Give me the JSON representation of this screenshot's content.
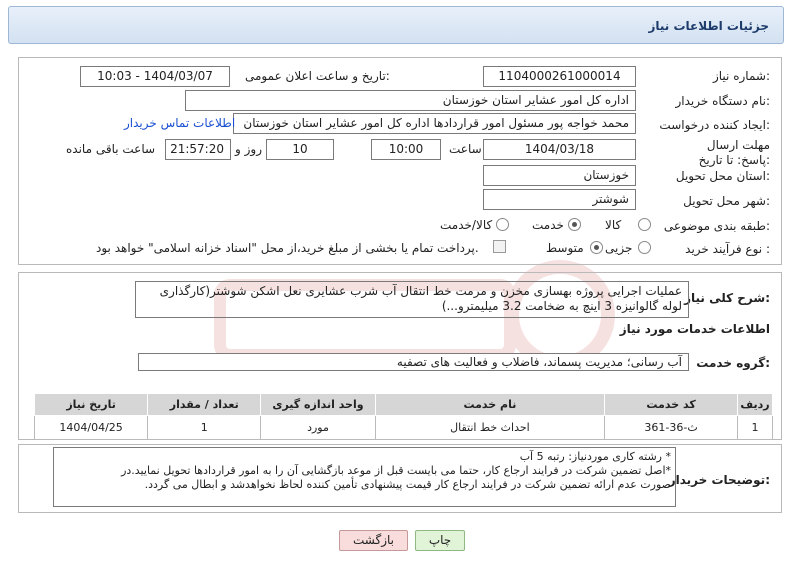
{
  "header": {
    "title": "جزئیات اطلاعات نیاز"
  },
  "fields": {
    "need_number_label": "شماره نیاز:",
    "need_number": "1104000261000014",
    "announce_label": "تاریخ و ساعت اعلان عمومی:",
    "announce_value": "1404/03/07 - 10:03",
    "buyer_label": "نام دستگاه خریدار:",
    "buyer_value": "اداره کل امور عشایر استان خوزستان",
    "creator_label": "ایجاد کننده درخواست:",
    "creator_value": "محمد خواجه پور مسئول امور قراردادها اداره کل امور عشایر استان خوزستان",
    "contact_link": "اطلاعات تماس خریدار",
    "deadline_label": "مهلت ارسال پاسخ: تا تاریخ:",
    "deadline_date": "1404/03/18",
    "time_label": "ساعت",
    "deadline_time": "10:00",
    "days_value": "10",
    "days_label": "روز و",
    "remaining_time": "21:57:20",
    "remaining_label": "ساعت باقی مانده",
    "province_label": "استان محل تحویل:",
    "province_value": "خوزستان",
    "city_label": "شهر محل تحویل:",
    "city_value": "شوشتر",
    "category_label": "طبقه بندی موضوعی:",
    "category_options": [
      "کالا",
      "خدمت",
      "کالا/خدمت"
    ],
    "process_label": "نوع فرآیند خرید :",
    "process_options": [
      "جزیی",
      "متوسط"
    ],
    "payment_note": "پرداخت تمام یا بخشی از مبلغ خرید،از محل \"اسناد خزانه اسلامی\" خواهد بود."
  },
  "summary": {
    "label": "شرح کلی نیاز:",
    "text": "عملیات اجرایی پروژه بهسازی مخزن و مرمت خط انتقال آب  شرب عشایری نعل اشکن شوشتر(کارگذاری لوله گالوانیزه 3 اینچ به ضخامت 3.2 میلیمترو...)"
  },
  "services": {
    "section_title": "اطلاعات خدمات مورد نیاز",
    "group_label": "گروه خدمت:",
    "group_value": "آب رسانی؛ مدیریت پسماند، فاضلاب و فعالیت های تصفیه",
    "columns": [
      "ردیف",
      "کد خدمت",
      "نام خدمت",
      "واحد اندازه گیری",
      "تعداد / مقدار",
      "تاریخ نیاز"
    ],
    "rows": [
      [
        "1",
        "ث-36-361",
        "احداث خط انتقال",
        "مورد",
        "1",
        "1404/04/25"
      ]
    ]
  },
  "buyer_notes": {
    "label": "توضیحات خریدار:",
    "line1": "* رشته کاری موردنیاز: رتبه 5 آب",
    "line2": "*اصل تضمین شرکت در فرایند ارجاع کار، حتما می بایست قبل از موعد بازگشایی  آن را به امور قراردادها تحویل نمایید.در",
    "line3": "صورت عدم ارائه تضمین شرکت در فرایند ارجاع کار قیمت پیشنهادی تأمین کننده لحاظ نخواهدشد و ابطال می گردد."
  },
  "buttons": {
    "print": "چاپ",
    "back": "بازگشت"
  },
  "colors": {
    "header_border": "#9db7d5",
    "print_btn": "#e1f4d8",
    "back_btn": "#f9dcdc"
  }
}
